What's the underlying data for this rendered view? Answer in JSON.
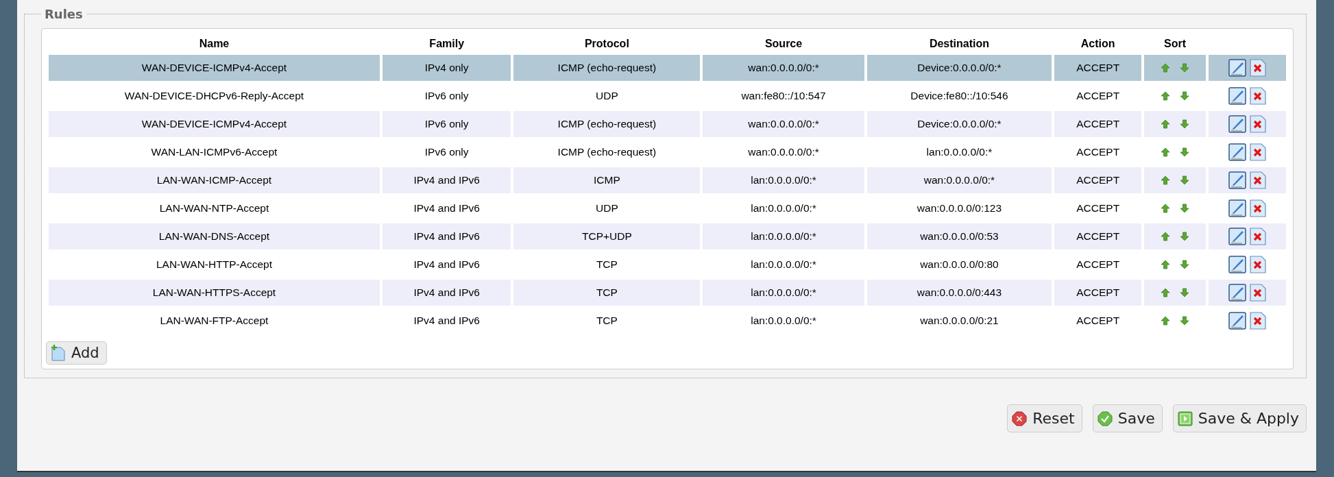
{
  "fieldset": {
    "legend": "Rules"
  },
  "table": {
    "columns": [
      "Name",
      "Family",
      "Protocol",
      "Source",
      "Destination",
      "Action",
      "Sort"
    ],
    "rows": [
      {
        "name": "WAN-DEVICE-ICMPv4-Accept",
        "family": "IPv4 only",
        "protocol": "ICMP (echo-request)",
        "source": "wan:0.0.0.0/0:*",
        "destination": "Device:0.0.0.0/0:*",
        "action": "ACCEPT",
        "selected": true
      },
      {
        "name": "WAN-DEVICE-DHCPv6-Reply-Accept",
        "family": "IPv6 only",
        "protocol": "UDP",
        "source": "wan:fe80::/10:547",
        "destination": "Device:fe80::/10:546",
        "action": "ACCEPT",
        "selected": false
      },
      {
        "name": "WAN-DEVICE-ICMPv4-Accept",
        "family": "IPv6 only",
        "protocol": "ICMP (echo-request)",
        "source": "wan:0.0.0.0/0:*",
        "destination": "Device:0.0.0.0/0:*",
        "action": "ACCEPT",
        "selected": false
      },
      {
        "name": "WAN-LAN-ICMPv6-Accept",
        "family": "IPv6 only",
        "protocol": "ICMP (echo-request)",
        "source": "wan:0.0.0.0/0:*",
        "destination": "lan:0.0.0.0/0:*",
        "action": "ACCEPT",
        "selected": false
      },
      {
        "name": "LAN-WAN-ICMP-Accept",
        "family": "IPv4 and IPv6",
        "protocol": "ICMP",
        "source": "lan:0.0.0.0/0:*",
        "destination": "wan:0.0.0.0/0:*",
        "action": "ACCEPT",
        "selected": false
      },
      {
        "name": "LAN-WAN-NTP-Accept",
        "family": "IPv4 and IPv6",
        "protocol": "UDP",
        "source": "lan:0.0.0.0/0:*",
        "destination": "wan:0.0.0.0/0:123",
        "action": "ACCEPT",
        "selected": false
      },
      {
        "name": "LAN-WAN-DNS-Accept",
        "family": "IPv4 and IPv6",
        "protocol": "TCP+UDP",
        "source": "lan:0.0.0.0/0:*",
        "destination": "wan:0.0.0.0/0:53",
        "action": "ACCEPT",
        "selected": false
      },
      {
        "name": "LAN-WAN-HTTP-Accept",
        "family": "IPv4 and IPv6",
        "protocol": "TCP",
        "source": "lan:0.0.0.0/0:*",
        "destination": "wan:0.0.0.0/0:80",
        "action": "ACCEPT",
        "selected": false
      },
      {
        "name": "LAN-WAN-HTTPS-Accept",
        "family": "IPv4 and IPv6",
        "protocol": "TCP",
        "source": "lan:0.0.0.0/0:*",
        "destination": "wan:0.0.0.0/0:443",
        "action": "ACCEPT",
        "selected": false
      },
      {
        "name": "LAN-WAN-FTP-Accept",
        "family": "IPv4 and IPv6",
        "protocol": "TCP",
        "source": "lan:0.0.0.0/0:*",
        "destination": "wan:0.0.0.0/0:21",
        "action": "ACCEPT",
        "selected": false
      }
    ]
  },
  "add_button": "Add",
  "buttons": [
    {
      "kind": "reset",
      "label": "Reset"
    },
    {
      "kind": "save",
      "label": "Save"
    },
    {
      "kind": "apply",
      "label": "Save & Apply"
    }
  ]
}
